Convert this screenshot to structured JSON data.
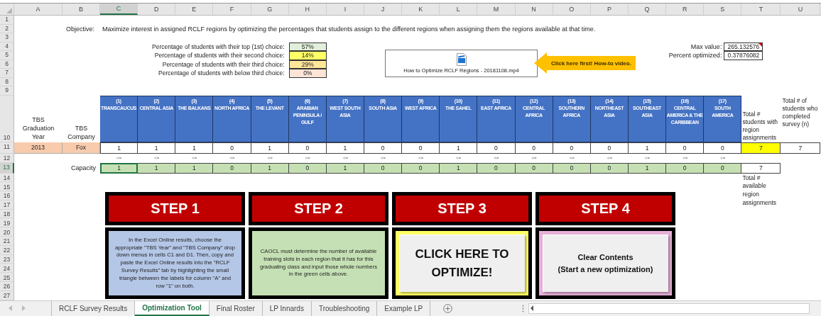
{
  "column_headers": [
    {
      "label": "A",
      "selected": false
    },
    {
      "label": "B",
      "selected": false
    },
    {
      "label": "C",
      "selected": true
    },
    {
      "label": "D",
      "selected": false
    },
    {
      "label": "E",
      "selected": false
    },
    {
      "label": "F",
      "selected": false
    },
    {
      "label": "G",
      "selected": false
    },
    {
      "label": "H",
      "selected": false
    },
    {
      "label": "I",
      "selected": false
    },
    {
      "label": "J",
      "selected": false
    },
    {
      "label": "K",
      "selected": false
    },
    {
      "label": "L",
      "selected": false
    },
    {
      "label": "M",
      "selected": false
    },
    {
      "label": "N",
      "selected": false
    },
    {
      "label": "O",
      "selected": false
    },
    {
      "label": "P",
      "selected": false
    },
    {
      "label": "Q",
      "selected": false
    },
    {
      "label": "R",
      "selected": false
    },
    {
      "label": "S",
      "selected": false
    },
    {
      "label": "T",
      "selected": false
    },
    {
      "label": "U",
      "selected": false
    }
  ],
  "row_numbers": [
    {
      "label": "1",
      "selected": false
    },
    {
      "label": "2",
      "selected": false
    },
    {
      "label": "3",
      "selected": false
    },
    {
      "label": "4",
      "selected": false
    },
    {
      "label": "5",
      "selected": false
    },
    {
      "label": "6",
      "selected": false
    },
    {
      "label": "7",
      "selected": false
    },
    {
      "label": "8",
      "selected": false
    },
    {
      "label": "9",
      "selected": false
    },
    {
      "label": "10",
      "selected": false
    },
    {
      "label": "11",
      "selected": false
    },
    {
      "label": "12",
      "selected": false
    },
    {
      "label": "13",
      "selected": true
    },
    {
      "label": "14",
      "selected": false
    },
    {
      "label": "15",
      "selected": false
    },
    {
      "label": "16",
      "selected": false
    },
    {
      "label": "17",
      "selected": false
    },
    {
      "label": "18",
      "selected": false
    },
    {
      "label": "19",
      "selected": false
    },
    {
      "label": "20",
      "selected": false
    },
    {
      "label": "21",
      "selected": false
    },
    {
      "label": "22",
      "selected": false
    },
    {
      "label": "23",
      "selected": false
    },
    {
      "label": "24",
      "selected": false
    },
    {
      "label": "25",
      "selected": false
    },
    {
      "label": "26",
      "selected": false
    },
    {
      "label": "27",
      "selected": false
    }
  ],
  "objective": {
    "label": "Objective:",
    "text": "Maximize interest in assigned RCLF regions by optimizing the percentages that students assign to the different regions when assigning them the regions available at that time."
  },
  "choice_stats": [
    {
      "label": "Percentage of students with their top (1st) choice:",
      "value": "57%",
      "color": "#e2efda"
    },
    {
      "label": "Percentage of students with their second choice:",
      "value": "14%",
      "color": "#ffff66"
    },
    {
      "label": "Percentage of students with their third choice:",
      "value": "29%",
      "color": "#ffe699"
    },
    {
      "label": "Percentage of students with below third choice:",
      "value": "0%",
      "color": "#fce4d6"
    }
  ],
  "optimization": [
    {
      "label": "Max value:",
      "value": "265.132576",
      "has_comment": true
    },
    {
      "label": "Percent optimized:",
      "value": "0.37876082",
      "has_comment": false
    }
  ],
  "video": {
    "filename": "How to Optimize RCLF Regions - 20181108.mp4",
    "callout": "Click here first! How-to video."
  },
  "table": {
    "graduation_year_header": "TBS Graduation Year",
    "company_header": "TBS Company",
    "total_assigned_header": "Total # students with region assignments",
    "survey_total_header": "Total # of students who completed survey (n)",
    "graduation_year": "2013",
    "company": "Fox",
    "total_assigned": "7",
    "survey_total": "7",
    "capacity_label": "Capacity",
    "total_capacity": "7",
    "total_capacity_label": "Total # available region assignments",
    "regions": [
      {
        "number": "(1)",
        "name": "TRANSCAUCUS",
        "assigned": "1",
        "constraint": "<=",
        "capacity": "1"
      },
      {
        "number": "(2)",
        "name": "CENTRAL ASIA",
        "assigned": "1",
        "constraint": "<=",
        "capacity": "1"
      },
      {
        "number": "(3)",
        "name": "THE BALKANS",
        "assigned": "1",
        "constraint": "<=",
        "capacity": "1"
      },
      {
        "number": "(4)",
        "name": "NORTH AFRICA",
        "assigned": "0",
        "constraint": "<=",
        "capacity": "0"
      },
      {
        "number": "(5)",
        "name": "THE LEVANT",
        "assigned": "1",
        "constraint": "<=",
        "capacity": "1"
      },
      {
        "number": "(6)",
        "name": "ARABIAN PENINSULA / GULF",
        "assigned": "0",
        "constraint": "<=",
        "capacity": "0"
      },
      {
        "number": "(7)",
        "name": "WEST SOUTH ASIA",
        "assigned": "1",
        "constraint": "<=",
        "capacity": "1"
      },
      {
        "number": "(8)",
        "name": "SOUTH ASIA",
        "assigned": "0",
        "constraint": "<=",
        "capacity": "0"
      },
      {
        "number": "(9)",
        "name": "WEST AFRICA",
        "assigned": "0",
        "constraint": "<=",
        "capacity": "0"
      },
      {
        "number": "(10)",
        "name": "THE SAHEL",
        "assigned": "1",
        "constraint": "<=",
        "capacity": "1"
      },
      {
        "number": "(11)",
        "name": "EAST AFRICA",
        "assigned": "0",
        "constraint": "<=",
        "capacity": "0"
      },
      {
        "number": "(12)",
        "name": "CENTRAL AFRICA",
        "assigned": "0",
        "constraint": "<=",
        "capacity": "0"
      },
      {
        "number": "(13)",
        "name": "SOUTHERN AFRICA",
        "assigned": "0",
        "constraint": "<=",
        "capacity": "0"
      },
      {
        "number": "(14)",
        "name": "NORTHEAST ASIA",
        "assigned": "0",
        "constraint": "<=",
        "capacity": "0"
      },
      {
        "number": "(15)",
        "name": "SOUTHEAST ASIA",
        "assigned": "1",
        "constraint": "<=",
        "capacity": "1"
      },
      {
        "number": "(16)",
        "name": "CENTRAL AMERICA & THE CARIBBEAN",
        "assigned": "0",
        "constraint": "<=",
        "capacity": "0"
      },
      {
        "number": "(17)",
        "name": "SOUTH AMERICA",
        "assigned": "0",
        "constraint": "<=",
        "capacity": "0"
      }
    ]
  },
  "steps": [
    {
      "title": "STEP 1",
      "kind": "note",
      "color": "#b4c7e7",
      "lines": [
        "In the Excel Online results, choose the appropriate \"TBS Year\" and \"TBS Company\" drop down menus in cells C1 and D1. Then, copy and paste the Excel Online results into the \"RCLF Survey Results\" tab by highlighting the small triangle between the labels for column \"A\" and row \"1\" on both."
      ]
    },
    {
      "title": "STEP 2",
      "kind": "note",
      "color": "#c5e0b4",
      "lines": [
        "CAOCL must determine the number of available training slots in each region that it has for this graduating class and input those whole numbers in the green cells above."
      ]
    },
    {
      "title": "STEP 3",
      "kind": "big_button",
      "color": "#ffff66",
      "lines": [
        "CLICK HERE TO",
        "OPTIMIZE!"
      ]
    },
    {
      "title": "STEP 4",
      "kind": "button",
      "color": "#e8b0d8",
      "lines": [
        "Clear Contents",
        "(Start a new optimization)"
      ]
    }
  ],
  "sheet_tabs": [
    {
      "label": "RCLF Survey Results",
      "selected": false
    },
    {
      "label": "Optimization Tool",
      "selected": true
    },
    {
      "label": "Final Roster",
      "selected": false
    },
    {
      "label": "LP Innards",
      "selected": false
    },
    {
      "label": "Troubleshooting",
      "selected": false
    },
    {
      "label": "Example LP",
      "selected": false
    }
  ]
}
